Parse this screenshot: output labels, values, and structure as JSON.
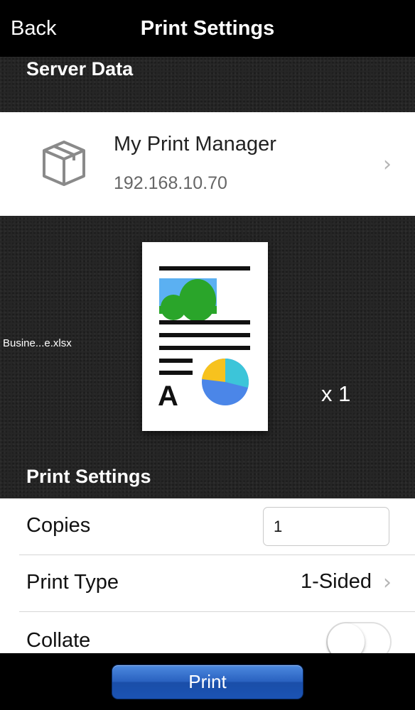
{
  "nav": {
    "back_label": "Back",
    "title": "Print Settings"
  },
  "server_section": {
    "header": "Server Data"
  },
  "server": {
    "name": "My Print Manager",
    "ip": "192.168.10.70",
    "icon": "box-icon"
  },
  "preview": {
    "filename": "Busine...e.xlsx",
    "copies_display": "x 1"
  },
  "settings_section": {
    "header": "Print Settings"
  },
  "settings": {
    "copies_label": "Copies",
    "copies_value": "1",
    "print_type_label": "Print Type",
    "print_type_value": "1-Sided",
    "collate_label": "Collate",
    "collate_on": false
  },
  "footer": {
    "print_label": "Print"
  },
  "colors": {
    "nav_bg": "#000000",
    "accent_blue": "#2a62c0",
    "chart_yellow": "#f7c21e",
    "chart_cyan": "#3cc5d9",
    "chart_blue": "#4b86e8",
    "image_green": "#2aa52a",
    "image_sky": "#5bb0f2"
  }
}
